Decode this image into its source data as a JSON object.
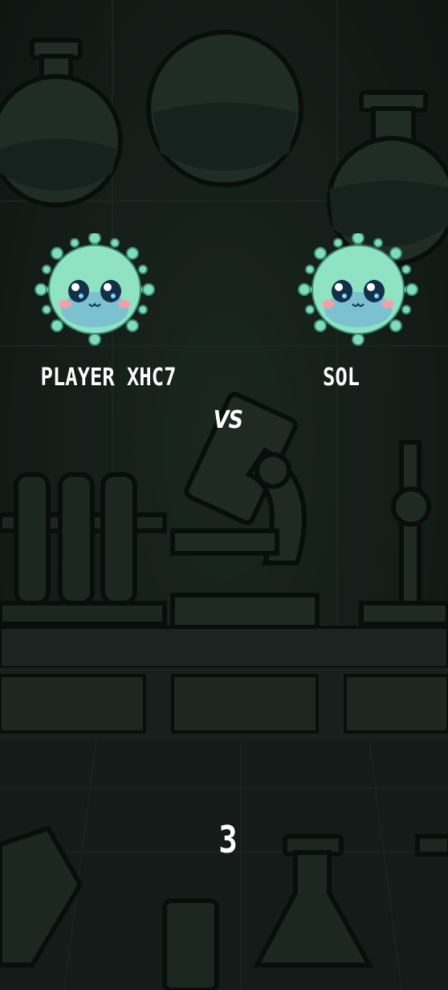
{
  "players": {
    "left": {
      "name": "PLAYER XHC7",
      "avatar_icon": "virus-mascot-icon"
    },
    "right": {
      "name": "SOL",
      "avatar_icon": "virus-mascot-icon"
    }
  },
  "vs_label": "VS",
  "countdown": "3",
  "colors": {
    "background": "#1a2520",
    "text": "#ffffff",
    "virus_body": "#8fe3c3",
    "virus_spike": "#6fd3b0"
  }
}
